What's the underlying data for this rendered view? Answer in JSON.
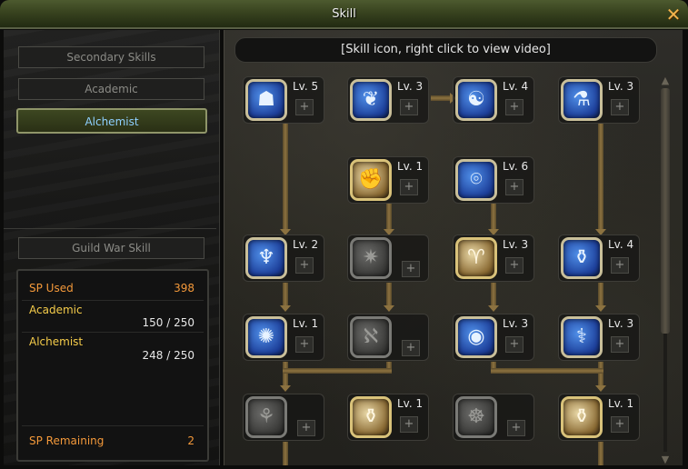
{
  "window": {
    "title": "Skill"
  },
  "tabs": {
    "secondary": "Secondary Skills",
    "academic": "Academic",
    "alchemist": "Alchemist",
    "guild_war": "Guild War Skill"
  },
  "stats": {
    "sp_used_label": "SP Used",
    "sp_used_value": "398",
    "academic_label": "Academic",
    "academic_value": "150 / 250",
    "alchemist_label": "Alchemist",
    "alchemist_value": "248 / 250",
    "sp_remaining_label": "SP Remaining",
    "sp_remaining_value": "2"
  },
  "hint": "[Skill icon, right click to view video]",
  "skills": [
    {
      "lv": "Lv. 5",
      "icon": "☗",
      "style": "blue"
    },
    {
      "lv": "Lv. 3",
      "icon": "❦",
      "style": "blue"
    },
    {
      "lv": "Lv. 4",
      "icon": "☯",
      "style": "blue"
    },
    {
      "lv": "Lv. 3",
      "icon": "⚗",
      "style": "blue"
    },
    {
      "lv": "Lv. 1",
      "icon": "✊",
      "style": "gold"
    },
    {
      "lv": "Lv. 6",
      "icon": "⌾",
      "style": "blue"
    },
    {
      "lv": "Lv. 2",
      "icon": "♆",
      "style": "blue"
    },
    {
      "lv": "",
      "icon": "✷",
      "style": "locked"
    },
    {
      "lv": "Lv. 3",
      "icon": "♈",
      "style": "gold"
    },
    {
      "lv": "Lv. 4",
      "icon": "⚱",
      "style": "blue"
    },
    {
      "lv": "Lv. 1",
      "icon": "✺",
      "style": "blue"
    },
    {
      "lv": "",
      "icon": "ℵ",
      "style": "locked"
    },
    {
      "lv": "Lv. 3",
      "icon": "◉",
      "style": "blue"
    },
    {
      "lv": "Lv. 3",
      "icon": "⚕",
      "style": "blue"
    },
    {
      "lv": "",
      "icon": "⚘",
      "style": "locked"
    },
    {
      "lv": "Lv. 1",
      "icon": "⚱",
      "style": "gold"
    },
    {
      "lv": "",
      "icon": "☸",
      "style": "locked"
    },
    {
      "lv": "Lv. 1",
      "icon": "⚱",
      "style": "gold"
    }
  ],
  "plus_label": "+",
  "icons": {
    "close": "✕",
    "scroll_up": "▲",
    "scroll_down": "▼"
  }
}
